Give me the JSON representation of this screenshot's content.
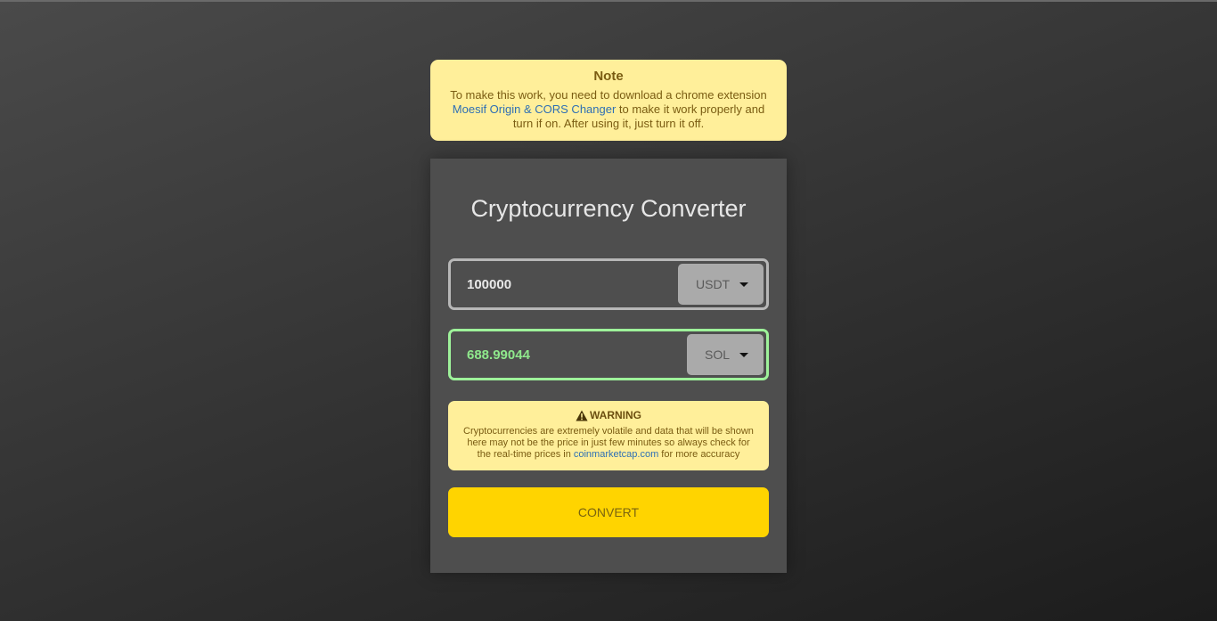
{
  "note": {
    "title": "Note",
    "text_before_link": "To make this work, you need to download a chrome extension ",
    "link_text": "Moesif Origin & CORS Changer",
    "text_after_link": " to make it work properly and turn if on. After using it, just turn it off."
  },
  "converter": {
    "title": "Cryptocurrency Converter",
    "from": {
      "value": "100000",
      "currency": "USDT"
    },
    "to": {
      "value": "688.99044",
      "currency": "SOL"
    },
    "warning": {
      "icon": "warning-triangle-icon",
      "title": "WARNING",
      "text_before_link": "Cryptocurrencies are extremely volatile and data that will be shown here may not be the price in just few minutes so always check for the real-time prices in ",
      "link_text": "coinmarketcap.com",
      "text_after_link": " for more accuracy"
    },
    "convert_label": "CONVERT"
  },
  "colors": {
    "note_background": "#ffef9a",
    "card_background": "#4e4e4e",
    "result_accent": "#9ef29a",
    "button": "#ffd400",
    "link": "#2f6fb4"
  }
}
